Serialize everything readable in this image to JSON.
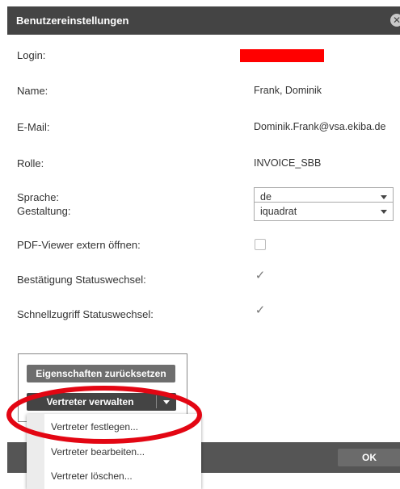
{
  "dialog": {
    "title": "Benutzereinstellungen"
  },
  "fields": {
    "login_label": "Login:",
    "name_label": "Name:",
    "name_value": "Frank, Dominik",
    "email_label": "E-Mail:",
    "email_value": "Dominik.Frank@vsa.ekiba.de",
    "role_label": "Rolle:",
    "role_value": "INVOICE_SBB",
    "language_label": "Sprache:",
    "language_value": "de",
    "theme_label": "Gestaltung:",
    "theme_value": "iquadrat",
    "pdf_label": "PDF-Viewer extern öffnen:",
    "pdf_checked": false,
    "confirm_label": "Bestätigung Statuswechsel:",
    "confirm_checked": true,
    "quick_label": "Schnellzugriff Statuswechsel:",
    "quick_checked": true
  },
  "buttons": {
    "reset": "Eigenschaften zurücksetzen",
    "manage_proxies": "Vertreter verwalten",
    "ok": "OK"
  },
  "menu": {
    "items": [
      "Vertreter festlegen...",
      "Vertreter bearbeiten...",
      "Vertreter löschen..."
    ]
  },
  "colors": {
    "titlebar": "#444444",
    "redaction": "#ff0000",
    "annotation_ellipse": "#e30613"
  },
  "icons": {
    "close": "close-icon",
    "dropdown": "chevron-down-icon",
    "checkmark": "checkmark-icon"
  }
}
